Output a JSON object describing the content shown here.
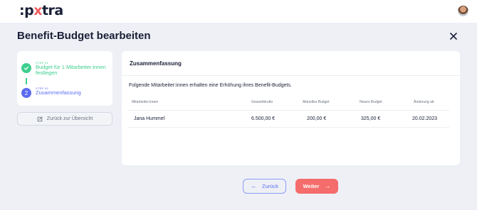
{
  "header": {
    "logo_prefix": ":p",
    "logo_x": "x",
    "logo_suffix": "tra"
  },
  "page": {
    "title": "Benefit-Budget bearbeiten"
  },
  "steps": [
    {
      "tag": "STEP 01",
      "label": "Budget für 1 Mitarbeiter:innen festlegen",
      "status": "done"
    },
    {
      "tag": "STEP 02",
      "label": "Zusammenfassung",
      "number": "2",
      "status": "active"
    }
  ],
  "sidebar": {
    "overview_label": "Zurück zur Übersicht"
  },
  "summary": {
    "title": "Zusammenfassung",
    "description": "Folgende Mitarbeiter:innen erhalten eine Erhöhung ihres Benefit-Budgets.",
    "columns": [
      "Mitarbeiter:innen",
      "Gesamtbrutto",
      "Aktuelles Budget",
      "Neues Budget",
      "Änderung ab"
    ],
    "rows": [
      {
        "name": "Jana Hummel",
        "gross": "6.500,00 €",
        "current": "200,00 €",
        "new": "325,00 €",
        "change_date": "20.02.2023"
      }
    ]
  },
  "footer": {
    "back_label": "Zurück",
    "next_label": "Weiter"
  },
  "colors": {
    "accent": "#5b6cf0",
    "success": "#3ecf8e",
    "cta": "#f56c6c",
    "logo_accent": "#f25c5c"
  }
}
